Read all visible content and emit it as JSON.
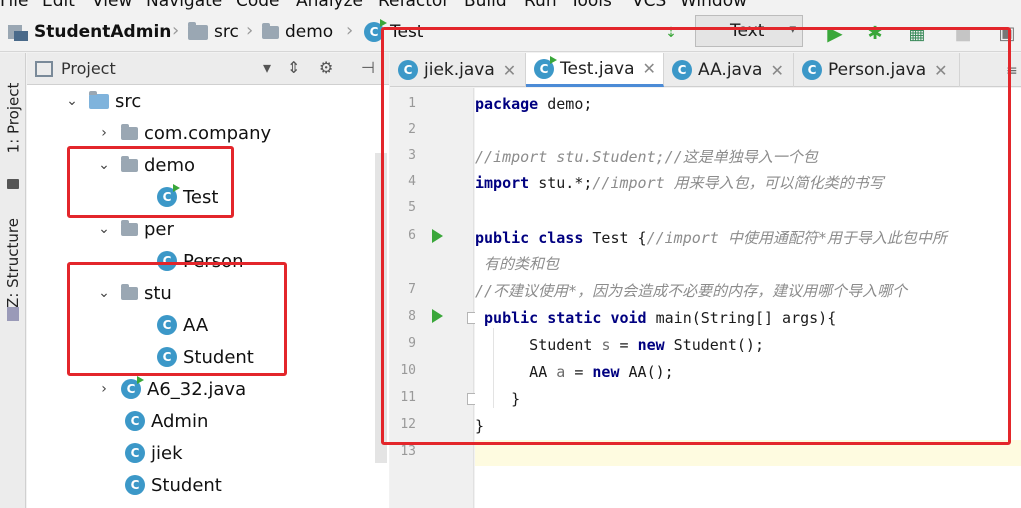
{
  "menubar": {
    "items": [
      "File",
      "Edit",
      "View",
      "Navigate",
      "Code",
      "Analyze",
      "Refactor",
      "Build",
      "Run",
      "Tools",
      "VCS",
      "Window"
    ]
  },
  "breadcrumb": {
    "project": "StudentAdmin",
    "folder": "src",
    "package": "demo",
    "file": "Test"
  },
  "toolbar": {
    "run_config": "Text"
  },
  "left_stripe": {
    "project_tab": "1: Project",
    "structure_tab": "Z: Structure"
  },
  "project_panel": {
    "title": "Project",
    "tree": [
      {
        "label": "src",
        "type": "folder",
        "arrow": "⌄"
      },
      {
        "label": "com.company",
        "type": "package",
        "arrow": "›"
      },
      {
        "label": "demo",
        "type": "package",
        "arrow": "⌄"
      },
      {
        "label": "Test",
        "type": "class"
      },
      {
        "label": "per",
        "type": "package",
        "arrow": "⌄"
      },
      {
        "label": "Person",
        "type": "class"
      },
      {
        "label": "stu",
        "type": "package",
        "arrow": "⌄"
      },
      {
        "label": "AA",
        "type": "class"
      },
      {
        "label": "Student",
        "type": "class"
      },
      {
        "label": "A6_32.java",
        "type": "class",
        "arrow": "›"
      },
      {
        "label": "Admin",
        "type": "class"
      },
      {
        "label": "jiek",
        "type": "class"
      },
      {
        "label": "Student",
        "type": "class"
      }
    ]
  },
  "editor": {
    "tabs": [
      {
        "label": "jiek.java",
        "active": false
      },
      {
        "label": "Test.java",
        "active": true
      },
      {
        "label": "AA.java",
        "active": false
      },
      {
        "label": "Person.java",
        "active": false
      }
    ],
    "line_numbers": [
      "1",
      "2",
      "3",
      "4",
      "5",
      "6",
      "7",
      "8",
      "9",
      "10",
      "11",
      "12",
      "13"
    ],
    "code": {
      "l1_kw": "package",
      "l1_rest": " demo;",
      "l3_comment": "//import stu.Student;//这是单独导入一个包",
      "l4_kw": "import",
      "l4_rest": " stu.*;",
      "l4_comment": "//import 用来导入包，可以简化类的书写",
      "l6_kw": "public class",
      "l6_rest": " Test {",
      "l6_comment": "//import 中使用通配符*用于导入此包中所",
      "l6_wrap": " 有的类和包",
      "l7_comment": "//不建议使用*，因为会造成不必要的内存，建议用哪个导入哪个",
      "l8_kw": " public static void",
      "l8_rest": " main(String[] args){",
      "l9_pre": "      Student ",
      "l9_var": "s",
      "l9_mid": " = ",
      "l9_kw": "new",
      "l9_post": " Student();",
      "l10_pre": "      AA ",
      "l10_var": "a",
      "l10_mid": " = ",
      "l10_kw": "new",
      "l10_post": " AA();",
      "l11": "    }",
      "l12": "}"
    }
  },
  "colors": {
    "keyword": "#000080",
    "comment": "#8c8c8c",
    "annotation_red": "#e3262b",
    "class_icon": "#3c98c8",
    "run_green": "#3aa73a"
  }
}
